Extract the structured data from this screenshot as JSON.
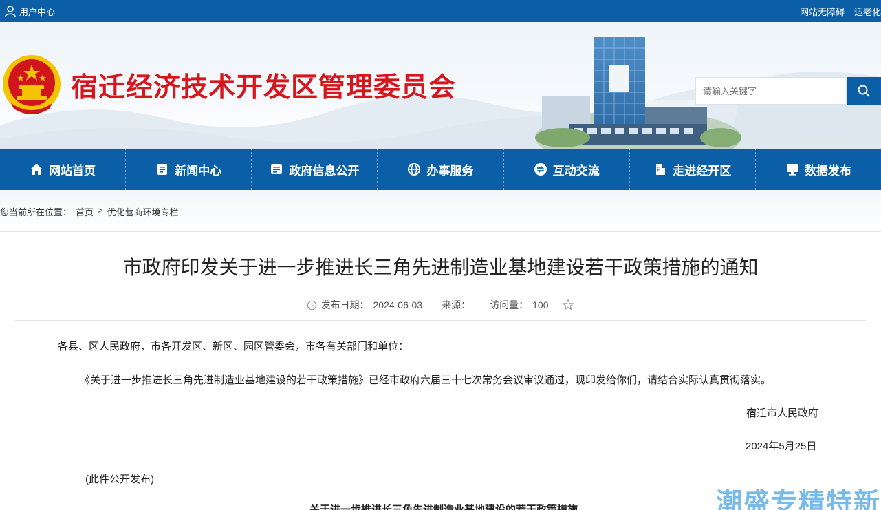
{
  "topbar": {
    "user_center": "用户中心",
    "accessibility": "网站无障碍",
    "elderly": "适老化"
  },
  "header": {
    "site_title": "宿迁经济技术开发区管理委员会",
    "search_placeholder": "请输入关键字"
  },
  "nav": {
    "items": [
      {
        "label": "网站首页",
        "icon": "home-icon"
      },
      {
        "label": "新闻中心",
        "icon": "news-icon"
      },
      {
        "label": "政府信息公开",
        "icon": "info-icon"
      },
      {
        "label": "办事服务",
        "icon": "globe-icon"
      },
      {
        "label": "互动交流",
        "icon": "exchange-icon"
      },
      {
        "label": "走进经开区",
        "icon": "building-icon"
      },
      {
        "label": "数据发布",
        "icon": "monitor-icon"
      }
    ]
  },
  "breadcrumb": {
    "prefix": "您当前所在位置：",
    "home": "首页",
    "sep": ">",
    "current": "优化营商环境专栏"
  },
  "article": {
    "title": "市政府印发关于进一步推进长三角先进制造业基地建设若干政策措施的通知",
    "date_label": "发布日期：",
    "date": "2024-06-03",
    "source_label": "来源：",
    "views_label": "访问量：",
    "views": "100",
    "salutation": "各县、区人民政府，市各开发区、新区、园区管委会，市各有关部门和单位：",
    "body": "《关于进一步推进长三角先进制造业基地建设的若干政策措施》已经市政府六届三十七次常务会议审议通过，现印发给你们，请结合实际认真贯彻落实。",
    "signer": "宿迁市人民政府",
    "sign_date": "2024年5月25日",
    "public_note": "(此件公开发布)",
    "sub_title_partial": "关于进一步推进长三角先进制造业基地建设的若干政策措施"
  },
  "watermark": "潮盛专精特新",
  "colors": {
    "primary_blue": "#0b5fa6",
    "title_red": "#d6161c",
    "emblem_red": "#d0161b",
    "emblem_gold": "#f5c400"
  }
}
